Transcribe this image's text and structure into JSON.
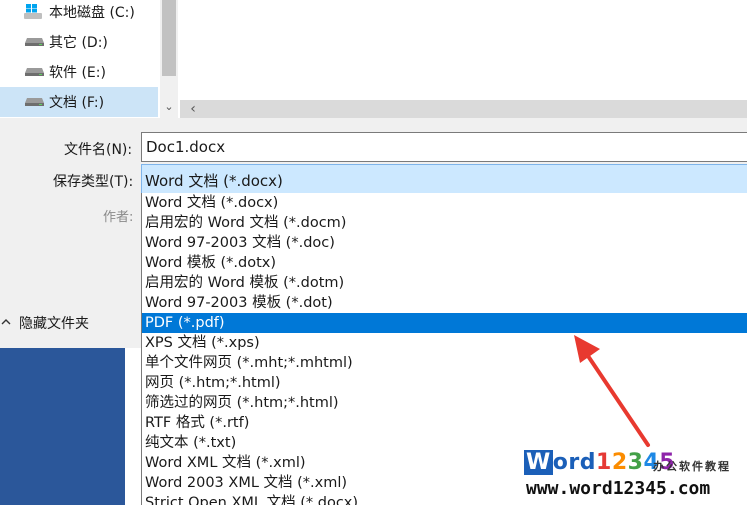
{
  "nav": {
    "items": [
      {
        "label": "本地磁盘 (C:)",
        "icon": "windows-drive-icon",
        "selected": false
      },
      {
        "label": "其它 (D:)",
        "icon": "drive-icon",
        "selected": false
      },
      {
        "label": "软件 (E:)",
        "icon": "drive-icon",
        "selected": false
      },
      {
        "label": "文档 (F:)",
        "icon": "drive-icon",
        "selected": true
      }
    ]
  },
  "form": {
    "filename_label": "文件名(N):",
    "filename_value": "Doc1.docx",
    "filetype_label": "保存类型(T):",
    "filetype_value": "Word 文档 (*.docx)",
    "author_label": "作者:",
    "hide_folders_label": "隐藏文件夹"
  },
  "dropdown": {
    "options": [
      "Word 文档 (*.docx)",
      "启用宏的 Word 文档 (*.docm)",
      "Word 97-2003 文档 (*.doc)",
      "Word 模板 (*.dotx)",
      "启用宏的 Word 模板 (*.dotm)",
      "Word 97-2003 模板 (*.dot)",
      "PDF (*.pdf)",
      "XPS 文档 (*.xps)",
      "单个文件网页 (*.mht;*.mhtml)",
      "网页 (*.htm;*.html)",
      "筛选过的网页 (*.htm;*.html)",
      "RTF 格式 (*.rtf)",
      "纯文本 (*.txt)",
      "Word XML 文档 (*.xml)",
      "Word 2003 XML 文档 (*.xml)",
      "Strict Open XML 文档 (*.docx)"
    ],
    "selected_index": 6
  },
  "watermark": {
    "brand": "Word12345",
    "tagline": "办公软件教程",
    "url": "www.word12345.com"
  },
  "colors": {
    "accent": "#0078d7",
    "selection_highlight": "#cce4f7",
    "arrow": "#e8392f",
    "app_blue": "#2b579a"
  }
}
